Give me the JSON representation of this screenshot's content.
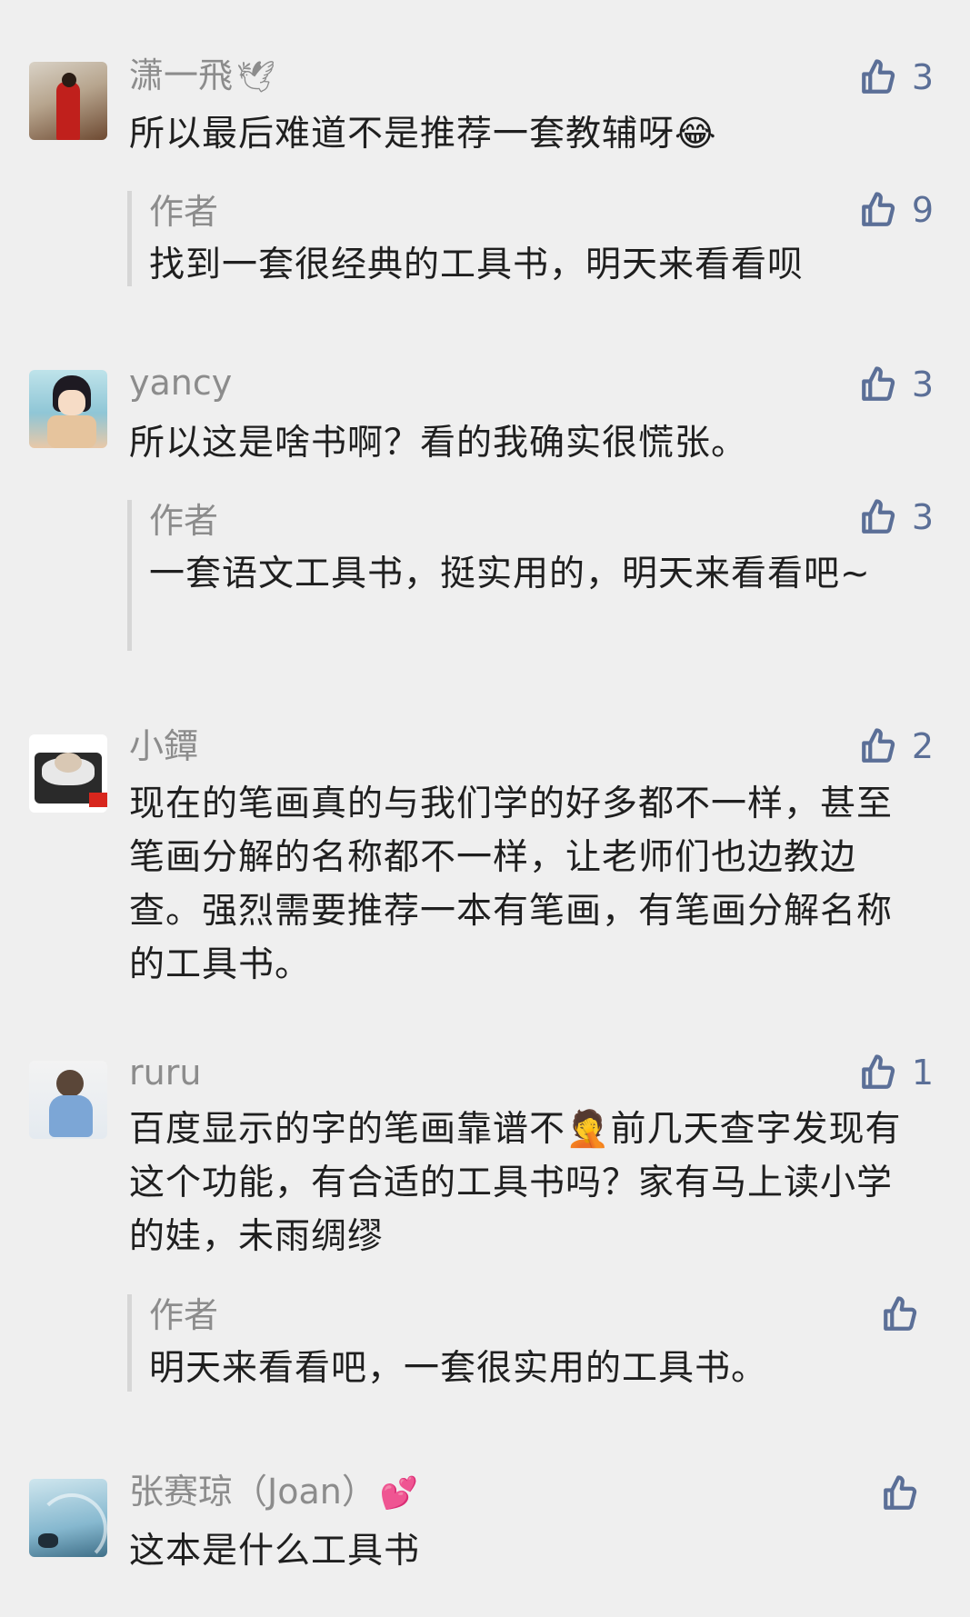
{
  "comments": [
    {
      "nickname": "潇一飛",
      "nickname_emoji": "🕊",
      "text": "所以最后难道不是推荐一套教辅呀😂",
      "likes": "3",
      "reply": {
        "author": "作者",
        "text": "找到一套很经典的工具书，明天来看看呗",
        "likes": "9"
      }
    },
    {
      "nickname": "yancy",
      "text": "所以这是啥书啊？看的我确实很慌张。",
      "likes": "3",
      "reply": {
        "author": "作者",
        "text": "一套语文工具书，挺实用的，明天来看看吧~",
        "likes": "3"
      }
    },
    {
      "nickname": "小鐔",
      "text": "现在的笔画真的与我们学的好多都不一样，甚至笔画分解的名称都不一样，让老师们也边教边查。强烈需要推荐一本有笔画，有笔画分解名称的工具书。",
      "likes": "2"
    },
    {
      "nickname": "ruru",
      "text": "百度显示的字的笔画靠谱不🤦前几天查字发现有这个功能，有合适的工具书吗？家有马上读小学的娃，未雨绸缪",
      "likes": "1",
      "reply": {
        "author": "作者",
        "text": "明天来看看吧，一套很实用的工具书。",
        "likes": ""
      }
    },
    {
      "nickname": "张赛琼（Joan）",
      "nickname_emoji": "💕",
      "text": "这本是什么工具书",
      "likes": ""
    }
  ],
  "colors": {
    "background": "#efefef",
    "name": "#8c8c8c",
    "like_icon": "#5b6f97",
    "reply_bar": "#d6d6d6"
  },
  "icons": {
    "like": "thumbs-up-icon"
  }
}
